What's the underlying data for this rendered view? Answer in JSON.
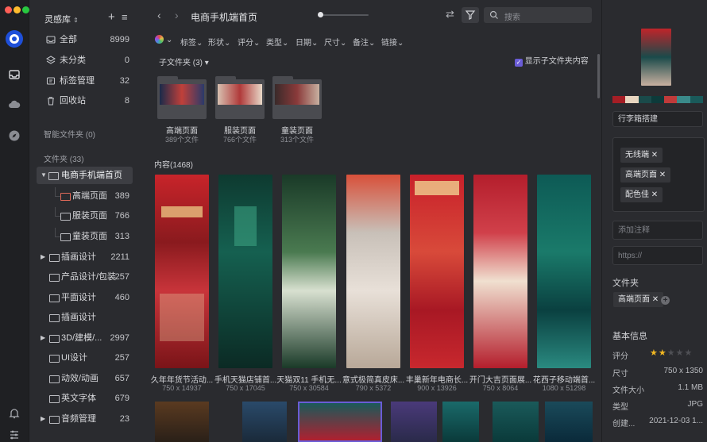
{
  "window": {
    "traffic_lights": [
      "#ff5f57",
      "#febc2e",
      "#28c840"
    ]
  },
  "rail": {
    "icons": [
      "app-logo-icon",
      "inbox-icon",
      "cloud-icon",
      "compass-icon",
      "bell-icon",
      "settings-sliders-icon"
    ]
  },
  "sidebar": {
    "library_name": "灵感库",
    "items": [
      {
        "label": "全部",
        "count": "8999",
        "icon": "inbox-icon"
      },
      {
        "label": "未分类",
        "count": "0",
        "icon": "layers-icon"
      },
      {
        "label": "标签管理",
        "count": "32",
        "icon": "tag-icon"
      },
      {
        "label": "回收站",
        "count": "8",
        "icon": "trash-icon"
      }
    ],
    "smart_folders_label": "智能文件夹 (0)",
    "folders_label": "文件夹 (33)",
    "folders": [
      {
        "label": "电商手机端首页",
        "count": "",
        "expanded": true,
        "selected": true
      },
      {
        "label": "高端页面",
        "count": "389",
        "child": true,
        "highlight": true
      },
      {
        "label": "服装页面",
        "count": "766",
        "child": true
      },
      {
        "label": "童装页面",
        "count": "313",
        "child": true
      },
      {
        "label": "插画设计",
        "count": "2211",
        "collapsed": true
      },
      {
        "label": "产品设计/包装",
        "count": "257"
      },
      {
        "label": "平面设计",
        "count": "460"
      },
      {
        "label": "插画设计",
        "count": ""
      },
      {
        "label": "3D/建模/...",
        "count": "2997",
        "collapsed": true
      },
      {
        "label": "UI设计",
        "count": "257"
      },
      {
        "label": "动效/动画",
        "count": "657"
      },
      {
        "label": "英文字体",
        "count": "679"
      },
      {
        "label": "音频管理",
        "count": "23",
        "collapsed": true
      }
    ]
  },
  "toolbar": {
    "title": "电商手机端首页",
    "search_placeholder": "搜索"
  },
  "filters": [
    "标签",
    "形状",
    "评分",
    "类型",
    "日期",
    "尺寸",
    "备注",
    "链接"
  ],
  "subfolders": {
    "label": "子文件夹 (3)",
    "show_sub_label": "显示子文件夹内容",
    "items": [
      {
        "name": "高端页面",
        "count": "389个文件"
      },
      {
        "name": "服装页面",
        "count": "766个文件"
      },
      {
        "name": "童装页面",
        "count": "313个文件"
      }
    ]
  },
  "content": {
    "label": "内容(1468)",
    "items": [
      {
        "title": "久年年货节活动...",
        "dims": "750 x 14937",
        "color": "#b4242a"
      },
      {
        "title": "手机天猫店铺首...",
        "dims": "750 x 17045",
        "color": "#0f4a3d"
      },
      {
        "title": "天猫双11 手机无...",
        "dims": "750 x 30584",
        "color": "#2d5a3a"
      },
      {
        "title": "意式极简真皮床...",
        "dims": "790 x 5372",
        "color": "#c0523c"
      },
      {
        "title": "丰巢新年电商长...",
        "dims": "900 x 13926",
        "color": "#c8212e"
      },
      {
        "title": "开门大吉页面展...",
        "dims": "750 x 8064",
        "color": "#b21e2c"
      },
      {
        "title": "花西子移动端首...",
        "dims": "1080 x 51298",
        "color": "#0d5a55"
      }
    ],
    "second_row_colors": [
      "#5a3a20",
      "#2a4a6a",
      "#b02030",
      "#4a3a7a",
      "#1a6a6a",
      "#1a5a5a",
      "#1a4a5a"
    ]
  },
  "inspector": {
    "palette": [
      "#a51e25",
      "#e8d6c0",
      "#1a4a4a",
      "#0d3a3a",
      "#c03a3a",
      "#3a8a8a",
      "#1a5a5a"
    ],
    "name": "行李箱搭建",
    "tags": [
      "无线端",
      "高端页面",
      "配色佳"
    ],
    "note_placeholder": "添加注释",
    "url_placeholder": "https://",
    "folder_label": "文件夹",
    "folder_chip": "高端页面",
    "info_label": "基本信息",
    "rows": [
      {
        "label": "评分",
        "value": ""
      },
      {
        "label": "尺寸",
        "value": "750 x 1350"
      },
      {
        "label": "文件大小",
        "value": "1.1 MB"
      },
      {
        "label": "类型",
        "value": "JPG"
      },
      {
        "label": "创建...",
        "value": "2021-12-03 1..."
      }
    ],
    "rating": 2
  }
}
